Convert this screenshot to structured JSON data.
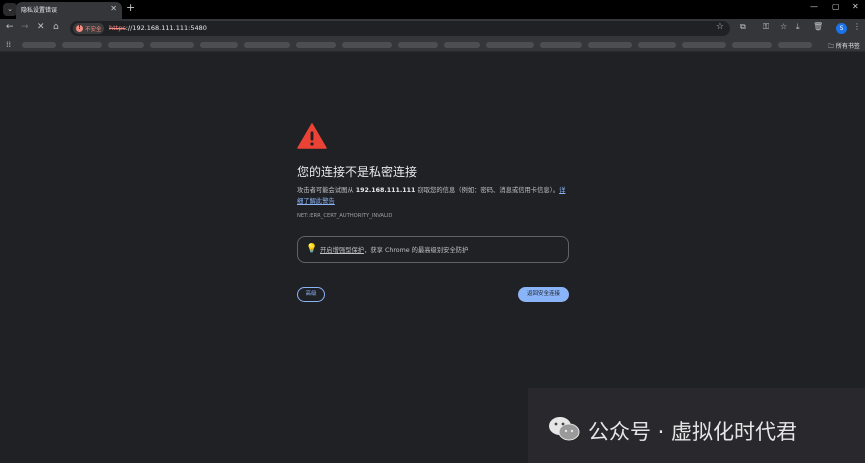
{
  "tab": {
    "title": "隐私设置错误",
    "close": "✕"
  },
  "tabstrip": {
    "menu_glyph": "⌄",
    "new_tab": "+",
    "minimize": "—",
    "maximize": "▢",
    "close": "✕"
  },
  "nav": {
    "back": "←",
    "forward": "→",
    "stop": "✕",
    "home": "⌂"
  },
  "omnibox": {
    "security_chip": "不安全",
    "url_scheme": "https",
    "url_rest": "://192.168.111.111:5480",
    "star": "☆"
  },
  "toolbar_icons": {
    "extensions": "⧉",
    "passwords": "⚿",
    "downloads": "⤓",
    "delete": "🗑",
    "menu": "⋮"
  },
  "profile": {
    "initial": "S"
  },
  "bookmarks": {
    "apps_glyph": "⁞⁞",
    "all_bookmarks": "所有书签"
  },
  "interstitial": {
    "heading": "您的连接不是私密连接",
    "desc_pre": "攻击者可能会试图从 ",
    "desc_host": "192.168.111.111",
    "desc_post": " 窃取您的信息（例如：密码、消息或信用卡信息）。",
    "learn_more": "详细了解此警告",
    "error_code": "NET::ERR_CERT_AUTHORITY_INVALID",
    "enhanced_link": "开启增强型保护",
    "enhanced_text": "，获享 Chrome 的最高级别安全防护",
    "details_button": "高级",
    "back_button": "返回安全连接"
  },
  "watermark": {
    "text": "公众号 · 虚拟化时代君"
  },
  "colors": {
    "warning": "#ea4335",
    "accent": "#8ab4f8",
    "background": "#202124"
  }
}
